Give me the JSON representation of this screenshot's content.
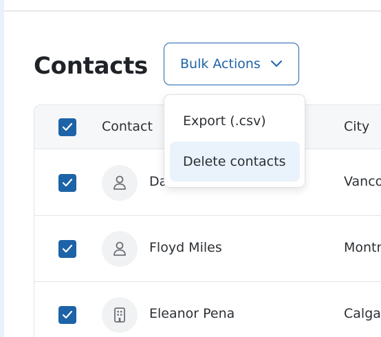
{
  "page": {
    "title": "Contacts"
  },
  "toolbar": {
    "bulk_actions_label": "Bulk Actions"
  },
  "bulk_menu": {
    "items": [
      {
        "label": "Export (.csv)",
        "highlighted": false
      },
      {
        "label": "Delete contacts",
        "highlighted": true
      }
    ]
  },
  "table": {
    "columns": [
      "Contact",
      "City"
    ],
    "header_checked": true,
    "rows": [
      {
        "name": "Da",
        "city": "Vanco",
        "checked": true,
        "avatar_icon": "person-icon"
      },
      {
        "name": "Floyd Miles",
        "city": "Montr",
        "checked": true,
        "avatar_icon": "person-icon"
      },
      {
        "name": "Eleanor Pena",
        "city": "Calgar",
        "checked": true,
        "avatar_icon": "building-icon"
      }
    ]
  },
  "colors": {
    "accent": "#1d63a8",
    "menu_highlight": "#eaf2fb",
    "header_bg": "#f6f7f8"
  }
}
